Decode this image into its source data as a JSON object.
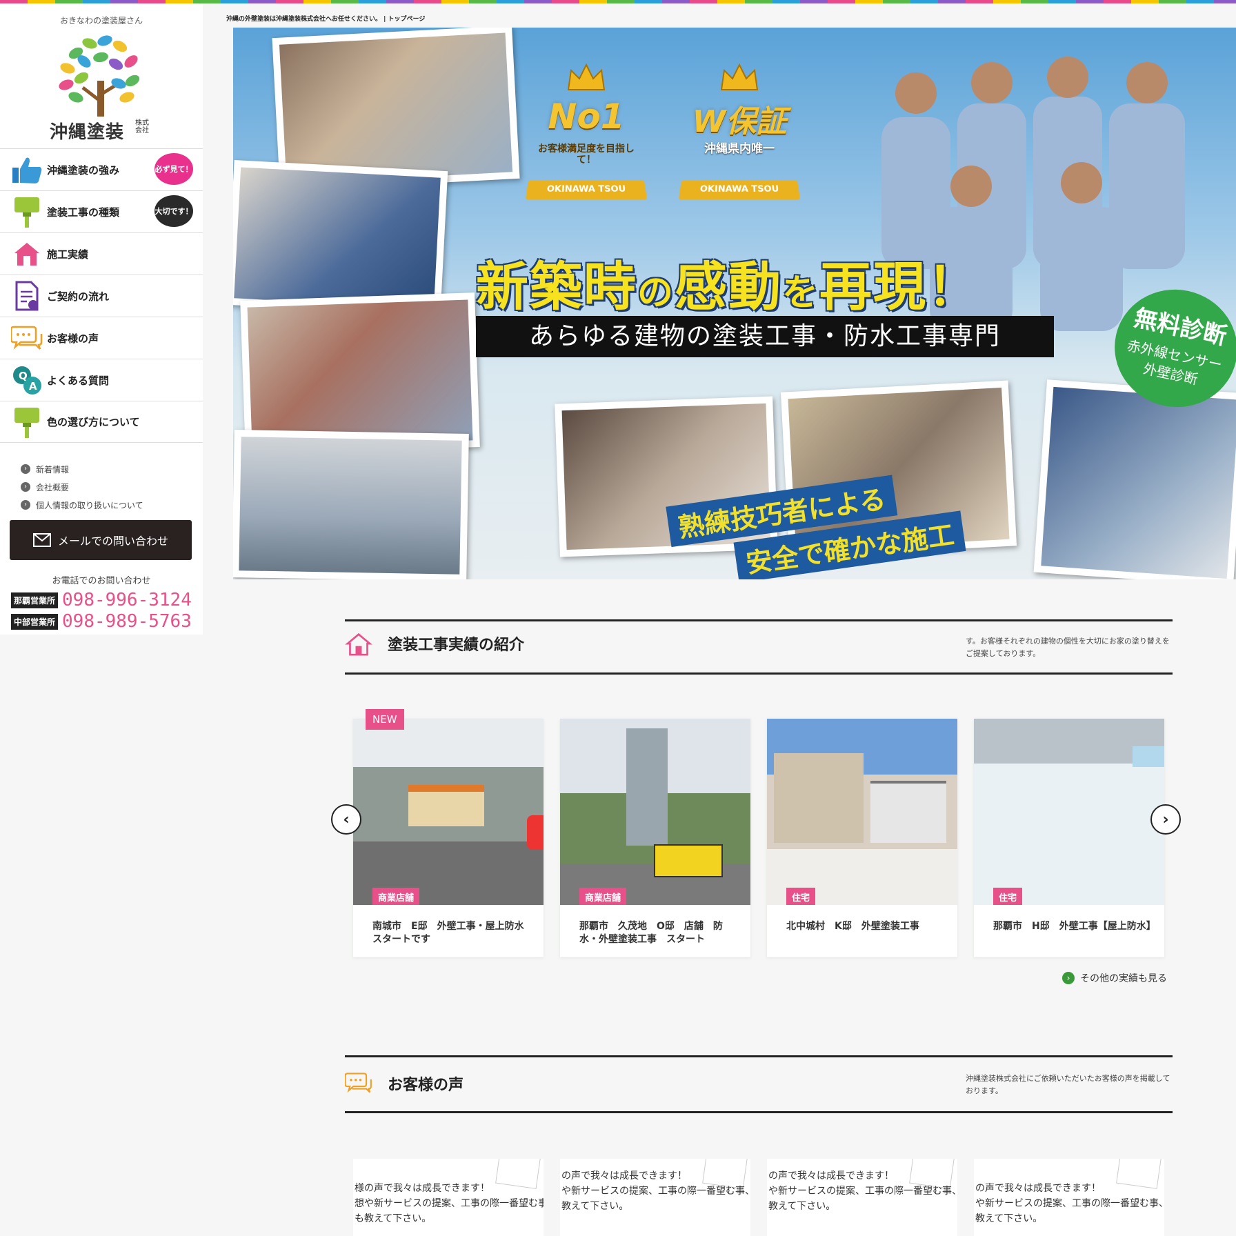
{
  "brand": {
    "tagline": "おきなわの塗装屋さん",
    "name": "沖縄塗装",
    "suffix": "株式会社"
  },
  "sidebar": {
    "items": [
      {
        "label": "沖縄塗装の強み",
        "badge": "必ず見て！",
        "icon": "thumbs-up-icon"
      },
      {
        "label": "塗装工事の種類",
        "badge": "大切です！",
        "icon": "paint-brush-icon"
      },
      {
        "label": "施工実績",
        "icon": "house-icon"
      },
      {
        "label": "ご契約の流れ",
        "icon": "contract-icon"
      },
      {
        "label": "お客様の声",
        "icon": "speech-bubble-icon"
      },
      {
        "label": "よくある質問",
        "icon": "qa-icon"
      },
      {
        "label": "色の選び方について",
        "icon": "paint-brush-icon"
      }
    ],
    "sublinks": [
      "新着情報",
      "会社概要",
      "個人情報の取り扱いについて"
    ],
    "mail_button": "メールでの問い合わせ",
    "tel_title": "お電話でのお問い合わせ",
    "tel": [
      {
        "office": "那覇営業所",
        "number": "098-996-3124"
      },
      {
        "office": "中部営業所",
        "number": "098-989-5763"
      }
    ]
  },
  "breadcrumb": "沖縄の外壁塗装は沖縄塗装株式会社へお任せください。 | トップページ",
  "hero": {
    "badge1": {
      "big": "No1",
      "sub": "お客様満足度を目指して！",
      "ribbon": "OKINAWA TSOU"
    },
    "badge2": {
      "big": "W保証",
      "sub": "沖縄県内唯一",
      "ribbon": "OKINAWA TSOU"
    },
    "headline_parts": [
      "新築時",
      "の",
      "感動",
      "を",
      "再現！"
    ],
    "subheadline": "あらゆる建物の塗装工事・防水工事専門",
    "diagnosis": {
      "title": "無料診断",
      "line1": "赤外線センサー",
      "line2": "外壁診断"
    },
    "craft": {
      "line1": "熟練技巧者による",
      "line2": "安全で確かな施工"
    }
  },
  "works": {
    "title": "塗装工事実績の紹介",
    "desc": "す。お客様それぞれの建物の個性を大切にお家の塗り替えをご提案しております。",
    "new_badge": "NEW",
    "cards": [
      {
        "category": "商業店舗",
        "title": "南城市　E邸　外壁工事・屋上防水　スタートです"
      },
      {
        "category": "商業店舗",
        "title": "那覇市　久茂地　O邸　店舗　防水・外壁塗装工事　スタート"
      },
      {
        "category": "住宅",
        "title": "北中城村　K邸　外壁塗装工事"
      },
      {
        "category": "住宅",
        "title": "那覇市　H邸　外壁工事【屋上防水】"
      }
    ],
    "prev": "‹",
    "next": "›",
    "more": "その他の実績も見る"
  },
  "voices": {
    "title": "お客様の声",
    "desc": "沖縄塗装株式会社にご依頼いただいたお客様の声を掲載しております。",
    "cards": [
      {
        "lines": [
          "様の声で我々は成長できます！",
          "想や新サービスの提案、工事の際一番望む事、",
          "も教えて下さい。"
        ]
      },
      {
        "lines": [
          "の声で我々は成長できます！",
          "や新サービスの提案、工事の際一番望む事、",
          "教えて下さい。"
        ]
      },
      {
        "lines": [
          "の声で我々は成長できます！",
          "や新サービスの提案、工事の際一番望む事、",
          "教えて下さい。"
        ]
      },
      {
        "lines": [
          "の声で我々は成長できます！",
          "や新サービスの提案、工事の際一番望む事、",
          "教えて下さい。"
        ]
      }
    ]
  },
  "colors": {
    "accent_pink": "#e8508a",
    "accent_green": "#3a9a3a",
    "headline_yellow": "#f6e21e"
  }
}
